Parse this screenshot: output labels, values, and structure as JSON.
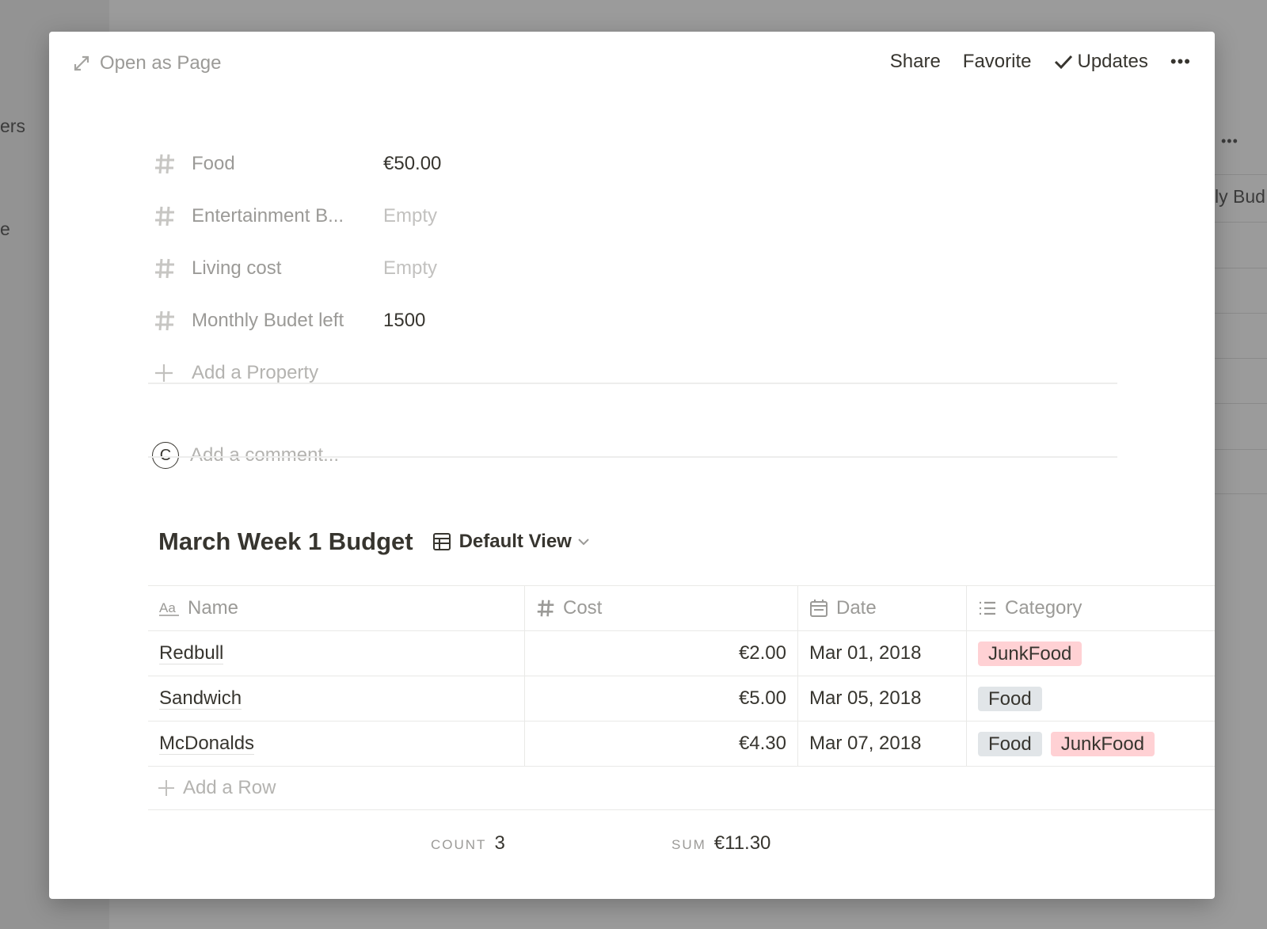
{
  "background": {
    "left_fragment_1": "ers",
    "left_fragment_2": "e",
    "right_fragment": "ly Bud",
    "right_more": "•••"
  },
  "topbar": {
    "open_as_page": "Open as Page",
    "share": "Share",
    "favorite": "Favorite",
    "updates": "Updates",
    "more": "•••"
  },
  "properties": [
    {
      "name": "Food",
      "value": "€50.00",
      "empty": false
    },
    {
      "name": "Entertainment B...",
      "value": "Empty",
      "empty": true
    },
    {
      "name": "Living cost",
      "value": "Empty",
      "empty": true
    },
    {
      "name": "Monthly Budet left",
      "value": "1500",
      "empty": false
    }
  ],
  "add_property": "Add a Property",
  "comment": {
    "avatar_letter": "C",
    "placeholder": "Add a comment..."
  },
  "database": {
    "title": "March Week 1 Budget",
    "view": "Default View",
    "columns": {
      "name": "Name",
      "cost": "Cost",
      "date": "Date",
      "category": "Category"
    },
    "rows": [
      {
        "name": "Redbull",
        "cost": "€2.00",
        "date": "Mar 01, 2018",
        "tags": [
          "JunkFood"
        ]
      },
      {
        "name": "Sandwich",
        "cost": "€5.00",
        "date": "Mar 05, 2018",
        "tags": [
          "Food"
        ]
      },
      {
        "name": "McDonalds",
        "cost": "€4.30",
        "date": "Mar 07, 2018",
        "tags": [
          "Food",
          "JunkFood"
        ]
      }
    ],
    "add_row": "Add a Row",
    "footer": {
      "count_label": "COUNT",
      "count_value": "3",
      "sum_label": "SUM",
      "sum_value": "€11.30"
    }
  },
  "tag_colors": {
    "JunkFood": "#ffd1d4",
    "Food": "#e1e5e8"
  }
}
